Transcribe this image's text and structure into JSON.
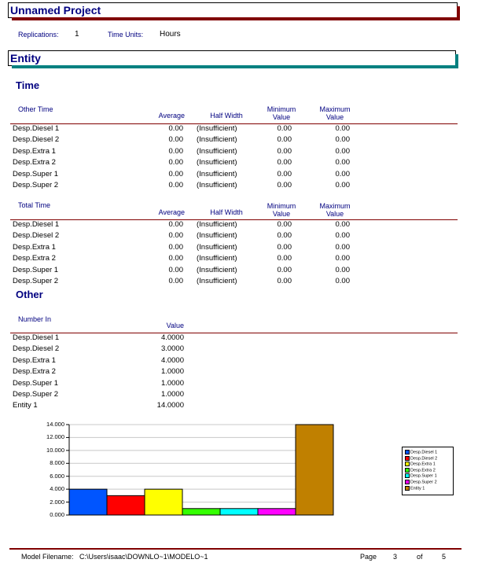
{
  "project_title": "Unnamed Project",
  "replications_label": "Replications:",
  "replications_value": "1",
  "time_units_label": "Time Units:",
  "time_units_value": "Hours",
  "entity_title": "Entity",
  "time_section": "Time",
  "columns": {
    "average": "Average",
    "half_width": "Half Width",
    "minimum": [
      "Minimum",
      "Value"
    ],
    "maximum": [
      "Maximum",
      "Value"
    ]
  },
  "other_time": {
    "title": "Other Time",
    "rows": [
      {
        "name": "Desp.Diesel 1",
        "avg": "0.00",
        "hw": "(Insufficient)",
        "min": "0.00",
        "max": "0.00"
      },
      {
        "name": "Desp.Diesel 2",
        "avg": "0.00",
        "hw": "(Insufficient)",
        "min": "0.00",
        "max": "0.00"
      },
      {
        "name": "Desp.Extra 1",
        "avg": "0.00",
        "hw": "(Insufficient)",
        "min": "0.00",
        "max": "0.00"
      },
      {
        "name": "Desp.Extra 2",
        "avg": "0.00",
        "hw": "(Insufficient)",
        "min": "0.00",
        "max": "0.00"
      },
      {
        "name": "Desp.Super 1",
        "avg": "0.00",
        "hw": "(Insufficient)",
        "min": "0.00",
        "max": "0.00"
      },
      {
        "name": "Desp.Super 2",
        "avg": "0.00",
        "hw": "(Insufficient)",
        "min": "0.00",
        "max": "0.00"
      }
    ]
  },
  "total_time": {
    "title": "Total Time",
    "rows": [
      {
        "name": "Desp.Diesel 1",
        "avg": "0.00",
        "hw": "(Insufficient)",
        "min": "0.00",
        "max": "0.00"
      },
      {
        "name": "Desp.Diesel 2",
        "avg": "0.00",
        "hw": "(Insufficient)",
        "min": "0.00",
        "max": "0.00"
      },
      {
        "name": "Desp.Extra 1",
        "avg": "0.00",
        "hw": "(Insufficient)",
        "min": "0.00",
        "max": "0.00"
      },
      {
        "name": "Desp.Extra 2",
        "avg": "0.00",
        "hw": "(Insufficient)",
        "min": "0.00",
        "max": "0.00"
      },
      {
        "name": "Desp.Super 1",
        "avg": "0.00",
        "hw": "(Insufficient)",
        "min": "0.00",
        "max": "0.00"
      },
      {
        "name": "Desp.Super 2",
        "avg": "0.00",
        "hw": "(Insufficient)",
        "min": "0.00",
        "max": "0.00"
      }
    ]
  },
  "other_section": "Other",
  "number_in": {
    "title": "Number In",
    "value_header": "Value",
    "rows": [
      {
        "name": "Desp.Diesel 1",
        "value": "4.0000"
      },
      {
        "name": "Desp.Diesel 2",
        "value": "3.0000"
      },
      {
        "name": "Desp.Extra 1",
        "value": "4.0000"
      },
      {
        "name": "Desp.Extra 2",
        "value": "1.0000"
      },
      {
        "name": "Desp.Super 1",
        "value": "1.0000"
      },
      {
        "name": "Desp.Super 2",
        "value": "1.0000"
      },
      {
        "name": "Entity 1",
        "value": "14.0000"
      }
    ]
  },
  "chart_data": {
    "type": "bar",
    "categories": [
      "Desp.Diesel 1",
      "Desp.Diesel 2",
      "Desp.Extra 1",
      "Desp.Extra 2",
      "Desp.Super 1",
      "Desp.Super 2",
      "Entity 1"
    ],
    "values": [
      4,
      3,
      4,
      1,
      1,
      1,
      14
    ],
    "colors": [
      "#0055ff",
      "#ff0000",
      "#ffff00",
      "#33ff00",
      "#00ffff",
      "#ff00ff",
      "#c08000"
    ],
    "yticks": [
      "0.000",
      "2.000",
      "4.000",
      "6.000",
      "8.000",
      "10.000",
      "12.000",
      "14.000"
    ],
    "ylim": [
      0,
      14
    ],
    "grid": true,
    "legend": "right"
  },
  "footer": {
    "model_label": "Model Filename:",
    "model_path": "C:\\Users\\isaac\\DOWNLO~1\\MODELO~1",
    "page_label": "Page",
    "page_num": "3",
    "of_label": "of",
    "page_total": "5"
  },
  "colors": {
    "navy": "#000080",
    "rule": "#800000",
    "teal": "#008080"
  }
}
